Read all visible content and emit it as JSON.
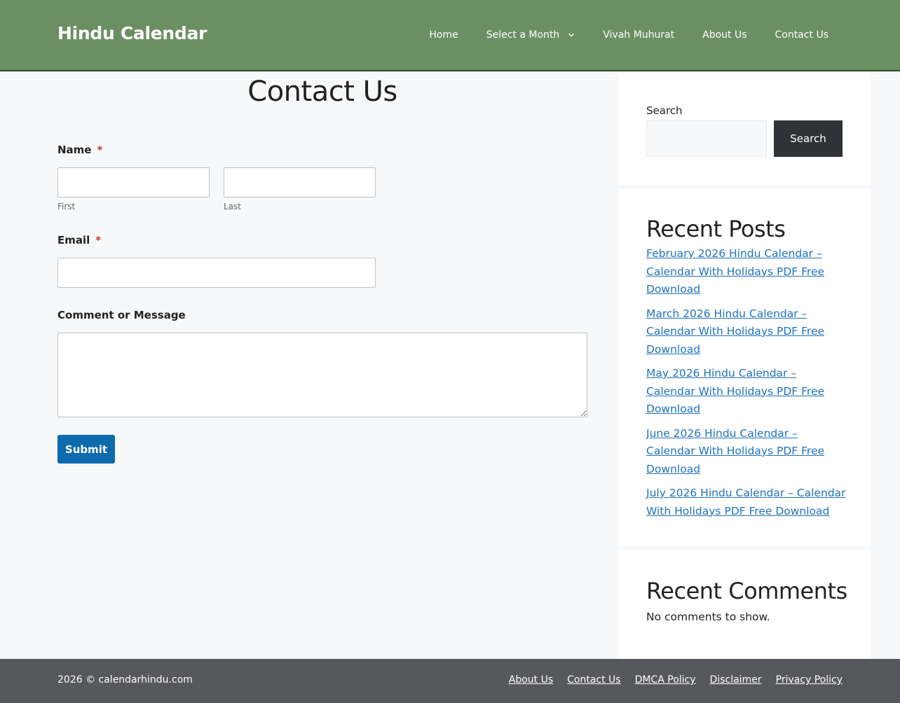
{
  "header": {
    "site_title": "Hindu Calendar",
    "nav": [
      {
        "label": "Home"
      },
      {
        "label": "Select a Month"
      },
      {
        "label": "Vivah Muhurat"
      },
      {
        "label": "About Us"
      },
      {
        "label": "Contact Us"
      }
    ]
  },
  "form": {
    "page_title": "Contact Us",
    "name_label": "Name",
    "required_mark": "*",
    "first_sublabel": "First",
    "last_sublabel": "Last",
    "first_value": "",
    "last_value": "",
    "email_label": "Email",
    "email_value": "",
    "message_label": "Comment or Message",
    "message_value": "",
    "submit_label": "Submit"
  },
  "sidebar": {
    "search_label": "Search",
    "search_value": "",
    "search_button": "Search",
    "recent_posts_title": "Recent Posts",
    "recent_posts": [
      "February 2026 Hindu Calendar – Calendar With Holidays PDF Free Download",
      "March 2026 Hindu Calendar – Calendar With Holidays PDF Free Download",
      "May 2026 Hindu Calendar – Calendar With Holidays PDF Free Download",
      "June 2026 Hindu Calendar – Calendar With Holidays PDF Free Download",
      "July 2026 Hindu Calendar – Calendar With Holidays PDF Free Download"
    ],
    "recent_comments_title": "Recent Comments",
    "no_comments": "No comments to show."
  },
  "footer": {
    "copyright": "2026 © calendarhindu.com",
    "links": [
      "About Us",
      "Contact Us",
      "DMCA Policy",
      "Disclaimer",
      "Privacy Policy"
    ]
  },
  "colors": {
    "header_bg": "#6b8f62",
    "submit_bg": "#0d6aad",
    "link": "#1e72bd",
    "footer_bg": "#575760",
    "required": "#c0392b"
  }
}
